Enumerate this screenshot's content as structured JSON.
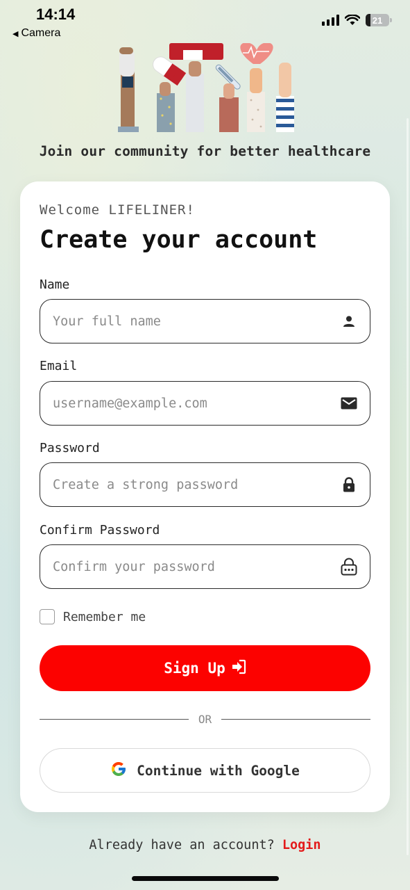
{
  "status_bar": {
    "time": "14:14",
    "back_app": "Camera",
    "battery_level": "21",
    "battery_fraction": 0.21
  },
  "hero": {
    "tagline": "Join our community for better healthcare"
  },
  "card": {
    "welcome": "Welcome LIFELINER!",
    "title": "Create your account",
    "fields": [
      {
        "label": "Name",
        "placeholder": "Your full name",
        "value": "",
        "icon": "person-icon"
      },
      {
        "label": "Email",
        "placeholder": "username@example.com",
        "value": "",
        "icon": "mail-icon"
      },
      {
        "label": "Password",
        "placeholder": "Create a strong password",
        "value": "",
        "icon": "lock-icon"
      },
      {
        "label": "Confirm Password",
        "placeholder": "Confirm your password",
        "value": "",
        "icon": "lock-dots-icon"
      }
    ],
    "remember_label": "Remember me",
    "remember_checked": false,
    "signup_label": "Sign Up",
    "divider_label": "OR",
    "google_label": "Continue with Google"
  },
  "footer": {
    "prompt": "Already have an account?",
    "login_label": "Login"
  },
  "colors": {
    "primary": "#fc0200",
    "link": "#e31b1b",
    "card_bg": "#ffffff",
    "text_dark": "#111111"
  }
}
